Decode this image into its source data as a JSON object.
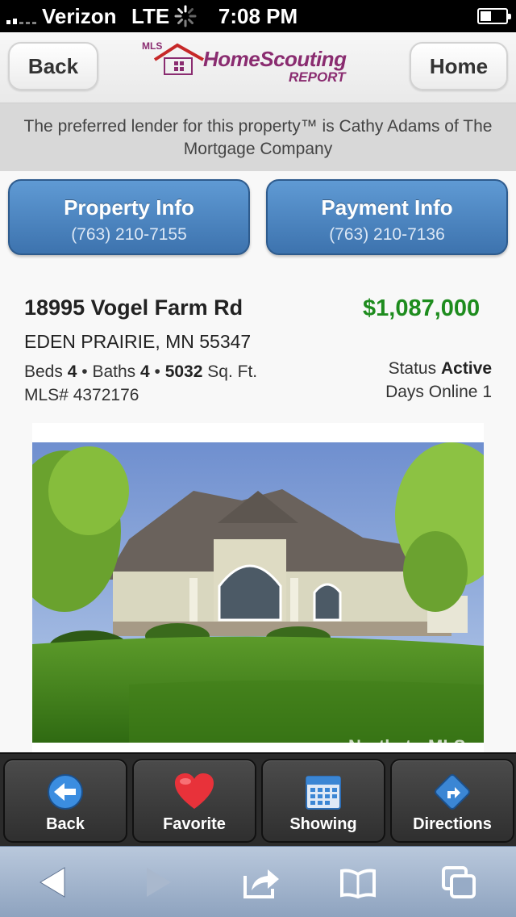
{
  "status_bar": {
    "carrier": "Verizon",
    "network": "LTE",
    "time": "7:08 PM",
    "signal_bars": 2,
    "battery_level": 0.4,
    "icons": [
      "signal-icon",
      "activity-spinner-icon",
      "battery-icon"
    ]
  },
  "header": {
    "back_label": "Back",
    "home_label": "Home",
    "logo": {
      "prefix": "MLS",
      "title": "HomeScouting",
      "subtitle": "REPORT",
      "colors": {
        "brand": "#8a2c70",
        "roof": "#c62828"
      }
    }
  },
  "lender_banner": {
    "text": "The preferred lender for this property™ is Cathy Adams of The Mortgage Company"
  },
  "info_buttons": [
    {
      "title": "Property Info",
      "phone": "(763) 210-7155"
    },
    {
      "title": "Payment Info",
      "phone": "(763) 210-7136"
    }
  ],
  "listing": {
    "address": "18995 Vogel Farm Rd",
    "city_state_zip": "EDEN PRAIRIE, MN 55347",
    "price": "$1,087,000",
    "beds_label": "Beds",
    "beds": "4",
    "baths_label": "Baths",
    "baths": "4",
    "sqft": "5032",
    "sqft_label": "Sq. Ft.",
    "mls_label": "MLS#",
    "mls_number": "4372176",
    "status_label": "Status",
    "status": "Active",
    "days_label": "Days Online",
    "days_online": "1",
    "photo_watermark": "NorthstarMLS",
    "colors": {
      "price": "#1e8c1e"
    }
  },
  "toolbar": {
    "items": [
      {
        "label": "Back",
        "icon": "back-arrow-icon"
      },
      {
        "label": "Favorite",
        "icon": "heart-icon"
      },
      {
        "label": "Showing",
        "icon": "calendar-icon"
      },
      {
        "label": "Directions",
        "icon": "directions-icon"
      }
    ]
  },
  "safari_bar": {
    "icons": [
      "safari-back-icon",
      "safari-forward-icon",
      "share-icon",
      "bookmarks-icon",
      "tabs-icon"
    ]
  }
}
